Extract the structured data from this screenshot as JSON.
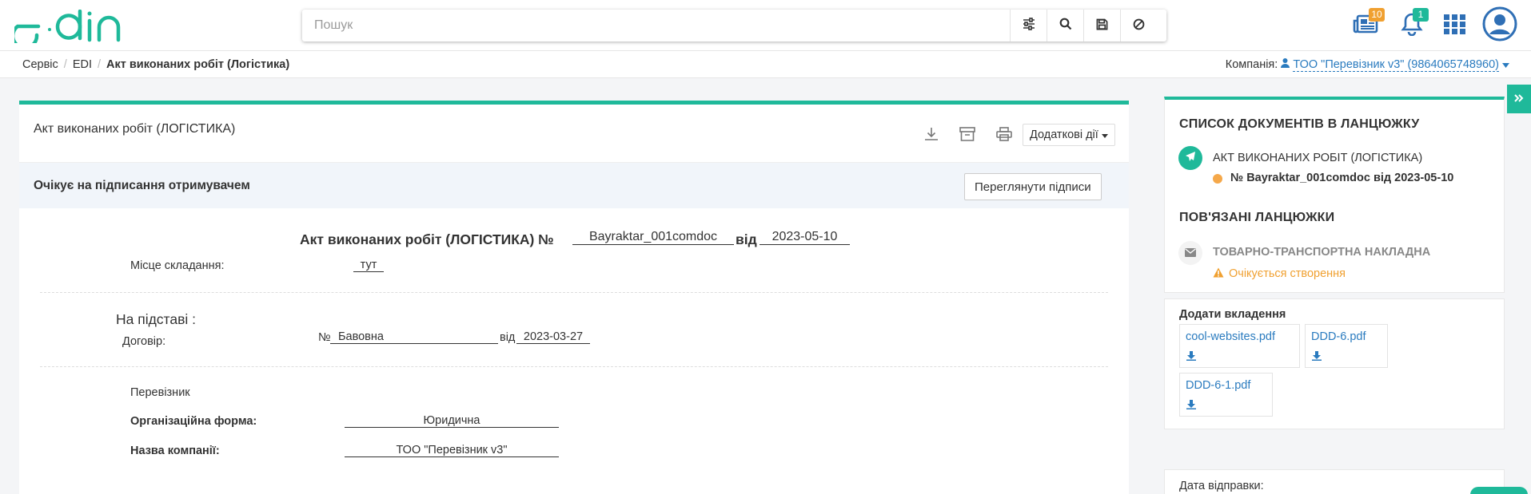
{
  "header": {
    "logo": "edin",
    "search_placeholder": "Пошук",
    "news_badge": "10",
    "notifications_badge": "1",
    "colors": {
      "accent": "#1fb99a",
      "news_badge": "#f0a030",
      "notify_badge": "#1fb99a",
      "icons": "#2f6fb5"
    }
  },
  "breadcrumb": {
    "items": [
      "Сервіс",
      "EDI"
    ],
    "current": "Акт виконаних робіт (Логістика)"
  },
  "company": {
    "label": "Компанія:",
    "value": "ТОО \"Перевізник v3\" (9864065748960)"
  },
  "document": {
    "header_title": "Акт виконаних робіт (ЛОГІСТИКА)",
    "more_actions": "Додаткові дії",
    "status": "Очікує на підписання отримувачем",
    "view_signatures": "Переглянути підписи",
    "form_title": "Акт виконаних робіт (ЛОГІСТИКА) №",
    "number": "Bayraktar_001comdoc",
    "from_label": "від",
    "date": "2023-05-10",
    "place_label": "Місце складання:",
    "place_value": "тут",
    "basis_heading": "На підставі :",
    "contract_label": "Договір:",
    "contract_no_prefix": "№",
    "contract_number": "Бавовна",
    "contract_from": "від",
    "contract_date": "2023-03-27",
    "carrier_heading": "Перевізник",
    "org_form_label": "Організаційна форма:",
    "org_form_value": "Юридична",
    "company_name_label": "Назва компанії:",
    "company_name_value": "ТОО \"Перевізник v3\""
  },
  "chain": {
    "title": "СПИСОК ДОКУМЕНТІВ В ЛАНЦЮЖКУ",
    "doc_name": "АКТ ВИКОНАНИХ РОБІТ (ЛОГІСТИКА)",
    "doc_number": "№ Bayraktar_001comdoc від 2023-05-10",
    "related_title": "ПОВ'ЯЗАНІ ЛАНЦЮЖКИ",
    "related_doc": "ТОВАРНО-ТРАНСПОРТНА НАКЛАДНА",
    "related_status": "Очікується створення",
    "colors": {
      "status_dot": "#f5a84a",
      "warning": "#f0a030"
    }
  },
  "attachments": {
    "title": "Додати вкладення",
    "files": [
      "cool-websites.pdf",
      "DDD-6.pdf",
      "DDD-6-1.pdf"
    ]
  },
  "send": {
    "label": "Дата відправки:"
  }
}
